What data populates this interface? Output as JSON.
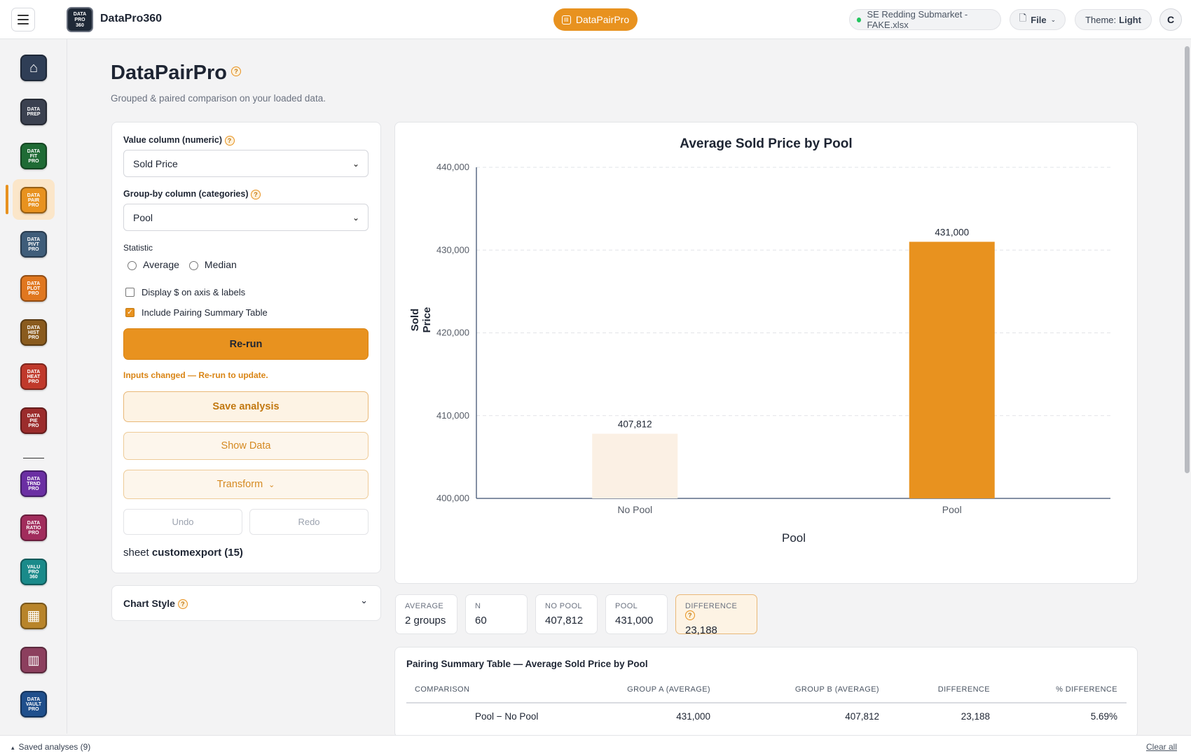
{
  "app": {
    "name": "DataPro360",
    "logo_text": "DATA PRO 360",
    "active_tool": "DataPairPro"
  },
  "topbar": {
    "file_chip": "SE Redding Submarket - FAKE.xlsx",
    "file_menu": "File",
    "theme_label": "Theme:",
    "theme_value": "Light",
    "avatar": "C"
  },
  "sidebar": {
    "apps": [
      {
        "id": "home",
        "label": "",
        "color": "#2f3e56"
      },
      {
        "id": "prep",
        "label": "DATA PREP",
        "color": "#3b4150"
      },
      {
        "id": "fit",
        "label": "DATA FIT PRO",
        "color": "#1f6b35"
      },
      {
        "id": "pair",
        "label": "DATA PAIR PRO",
        "color": "#e8921f"
      },
      {
        "id": "pivt",
        "label": "DATA PIVT PRO",
        "color": "#3f5d7a"
      },
      {
        "id": "plot",
        "label": "DATA PLOT PRO",
        "color": "#e0771f"
      },
      {
        "id": "hist",
        "label": "DATA HIST PRO",
        "color": "#8a5b1e"
      },
      {
        "id": "heat",
        "label": "DATA HEAT PRO",
        "color": "#c0392b"
      },
      {
        "id": "pie",
        "label": "DATA PIE PRO",
        "color": "#9b2c2c"
      },
      {
        "id": "trnd",
        "label": "DATA TRND PRO",
        "color": "#6b2fa3"
      },
      {
        "id": "ratio",
        "label": "DATA RATIO PRO",
        "color": "#a12c5c"
      },
      {
        "id": "valu",
        "label": "VALU PRO 360",
        "color": "#1a8a8a"
      },
      {
        "id": "cols",
        "label": "",
        "color": "#b8842a"
      },
      {
        "id": "report",
        "label": "",
        "color": "#8c3f5e"
      },
      {
        "id": "vault",
        "label": "DATA VAULT PRO",
        "color": "#1f4f8c"
      }
    ]
  },
  "page": {
    "title": "DataPairPro",
    "subtitle": "Grouped & paired comparison on your loaded data."
  },
  "controls": {
    "value_label": "Value column (numeric)",
    "value_selected": "Sold Price",
    "group_label": "Group-by column (categories)",
    "group_selected": "Pool",
    "statistic_label": "Statistic",
    "stat_average": "Average",
    "stat_median": "Median",
    "display_dollar": "Display $ on axis & labels",
    "include_summary": "Include Pairing Summary Table",
    "rerun": "Re-run",
    "warning": "Inputs changed — Re-run to update.",
    "save": "Save analysis",
    "show_data": "Show Data",
    "transform": "Transform",
    "undo": "Undo",
    "redo": "Redo",
    "sheet_prefix": "sheet",
    "sheet_name": "customexport (15)"
  },
  "chart_style": {
    "label": "Chart Style"
  },
  "chart_data": {
    "type": "bar",
    "title": "Average Sold Price by Pool",
    "xlabel": "Pool",
    "ylabel": "Sold Price",
    "categories": [
      "No Pool",
      "Pool"
    ],
    "values": [
      407812,
      431000
    ],
    "value_labels": [
      "407,812",
      "431,000"
    ],
    "colors": [
      "#fbf0e4",
      "#e8921f"
    ],
    "ylim": [
      400000,
      440000
    ],
    "yticks": [
      400000,
      410000,
      420000,
      430000,
      440000
    ],
    "ytick_labels": [
      "400,000",
      "410,000",
      "420,000",
      "430,000",
      "440,000"
    ],
    "grid": true
  },
  "stats": [
    {
      "key": "AVERAGE",
      "value": "2 groups"
    },
    {
      "key": "N",
      "value": "60"
    },
    {
      "key": "NO POOL",
      "value": "407,812"
    },
    {
      "key": "POOL",
      "value": "431,000"
    },
    {
      "key": "DIFFERENCE",
      "value": "23,188"
    }
  ],
  "summary_table": {
    "title": "Pairing Summary Table — Average Sold Price by Pool",
    "headers": [
      "COMPARISON",
      "GROUP A (AVERAGE)",
      "GROUP B (AVERAGE)",
      "DIFFERENCE",
      "% DIFFERENCE"
    ],
    "rows": [
      [
        "Pool − No Pool",
        "431,000",
        "407,812",
        "23,188",
        "5.69%"
      ]
    ]
  },
  "bottombar": {
    "saved": "Saved analyses (9)",
    "clear": "Clear all"
  }
}
